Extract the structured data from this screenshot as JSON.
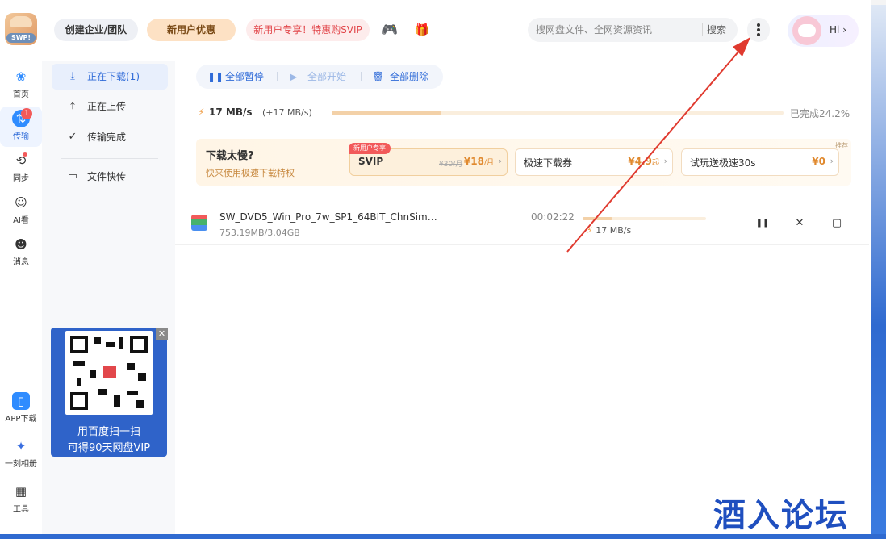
{
  "header": {
    "logo_tag": "SWP!",
    "enterprise_btn": "创建企业/团队",
    "new_user_btn": "新用户优惠",
    "promo_btn": "新用户专享！特惠购SVIP",
    "game_icon": "gamepad-icon",
    "gift_icon": "gift-icon",
    "search_placeholder": "搜网盘文件、全网资源资讯",
    "search_btn": "搜索",
    "user_greeting": "Hi",
    "user_chevron": "›"
  },
  "left_nav": {
    "items": [
      {
        "label": "首页",
        "icon": "home-icon",
        "glyph": "❀"
      },
      {
        "label": "传输",
        "icon": "transfer-icon",
        "glyph": "⇅",
        "badge": "1"
      },
      {
        "label": "同步",
        "icon": "sync-icon",
        "glyph": "⟲"
      },
      {
        "label": "AI看",
        "icon": "ai-icon",
        "glyph": "☺"
      },
      {
        "label": "消息",
        "icon": "message-icon",
        "glyph": "☻"
      }
    ],
    "bottom_items": [
      {
        "label": "APP下载",
        "icon": "phone-icon",
        "glyph": "▯"
      },
      {
        "label": "一刻相册",
        "icon": "album-icon",
        "glyph": "✦"
      },
      {
        "label": "工具",
        "icon": "tools-icon",
        "glyph": "▦"
      }
    ]
  },
  "side_nav": {
    "items": [
      {
        "label": "正在下载(1)",
        "glyph": "⤓"
      },
      {
        "label": "正在上传",
        "glyph": "⤒"
      },
      {
        "label": "传输完成",
        "glyph": "✓"
      }
    ],
    "quick_transfer": {
      "label": "文件快传",
      "glyph": "▭"
    }
  },
  "qr_ad": {
    "line1": "用百度扫一扫",
    "line2": "可得90天网盘VIP",
    "close": "✕"
  },
  "toolbar": {
    "pause_all": "全部暂停",
    "start_all": "全部开始",
    "delete_all": "全部删除",
    "pause_glyph": "❚❚",
    "start_glyph": "▶",
    "delete_glyph": "🗑"
  },
  "speed": {
    "glyph": "⚡",
    "value": "17 MB/s",
    "boost": "(+17 MB/s)",
    "progress": 0.242,
    "done_text": "已完成24.2%"
  },
  "promo": {
    "title": "下载太慢?",
    "subtitle": "快来使用极速下载特权",
    "ad_tag": "推荐",
    "cards": [
      {
        "tag": "新用户专享",
        "name": "SVIP",
        "strike": "¥30/月",
        "price": "¥18",
        "unit": "/月"
      },
      {
        "name": "极速下载券",
        "price": "¥4.9",
        "unit": "起"
      },
      {
        "name": "试玩送极速30s",
        "price": "¥0",
        "unit": ""
      }
    ],
    "arrow": "›"
  },
  "download": {
    "file_name": "SW_DVD5_Win_Pro_7w_SP1_64BIT_ChnSimp...",
    "size": "753.19MB/3.04GB",
    "time": "00:02:22",
    "speed": "17 MB/s",
    "progress": 0.242,
    "pause_glyph": "❚❚",
    "cancel_glyph": "✕",
    "folder_glyph": "▢"
  },
  "watermark": "酒入论坛",
  "colors": {
    "accent": "#2f6bd8",
    "brand_orange": "#f0a04b",
    "promo_red": "#e2474b",
    "annotation_arrow": "#e03a2f"
  }
}
